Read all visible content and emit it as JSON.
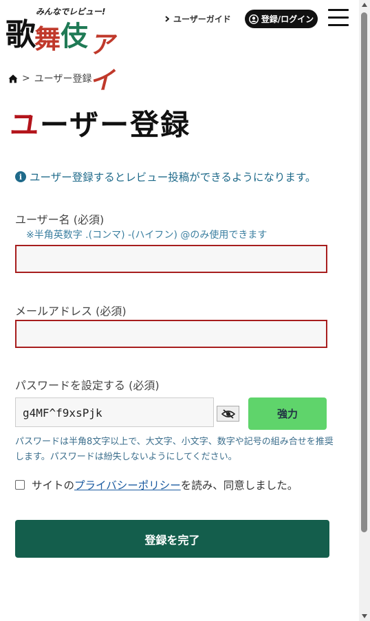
{
  "header": {
    "logo_tagline": "みんなでレビュー!",
    "logo_chars": [
      "歌",
      "舞",
      "伎",
      "アイ"
    ],
    "guide_link": "ユーザーガイド",
    "login_button": "登録/ログイン"
  },
  "breadcrumb": {
    "separator": ">",
    "current": "ユーザー登録"
  },
  "page_title": {
    "first": "ユ",
    "rest": "ーザー登録"
  },
  "info_text": "ユーザー登録するとレビュー投稿ができるようになります。",
  "form": {
    "username_label": "ユーザー名 (必須)",
    "username_hint": "※半角英数字 .(コンマ) -(ハイフン) @のみ使用できます",
    "username_value": "",
    "email_label": "メールアドレス (必須)",
    "email_value": "",
    "password_label": "パスワードを設定する (必須)",
    "password_value": "g4MF^f9xsPjk",
    "strength_label": "強力",
    "password_hint": "パスワードは半角8文字以上で、大文字、小文字、数字や記号の組み合せを推奨します。パスワードは紛失しないようにしてください。",
    "consent_prefix": "サイトの",
    "consent_link": "プライバシーポリシー",
    "consent_suffix": "を読み、同意しました。",
    "consent_checked": false,
    "submit_label": "登録を完了"
  },
  "colors": {
    "accent_red": "#b3141b",
    "submit_green": "#145e4c",
    "strength_green": "#5fd46b",
    "info_blue": "#1f6a8a"
  }
}
